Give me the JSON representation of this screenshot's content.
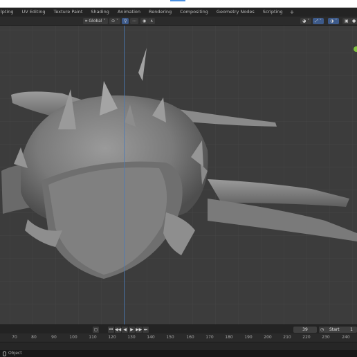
{
  "workspace_tabs": [
    "lpting",
    "UV Editing",
    "Texture Paint",
    "Shading",
    "Animation",
    "Rendering",
    "Compositing",
    "Geometry Nodes",
    "Scripting"
  ],
  "add_tab_label": "+",
  "header": {
    "transform_orientation": "Global",
    "pivot_label": "⊙",
    "snap_label": "⚲",
    "proportional_label": "◉",
    "overlay_icon": "overlay-icon",
    "shading_icon": "viewport-shading-icon"
  },
  "timeline": {
    "current_frame": "39",
    "start_label": "Start",
    "start_value": "1",
    "buttons": [
      "⏮",
      "◀◀",
      "◀",
      "▶",
      "▶▶",
      "⏭"
    ]
  },
  "ruler_ticks": [
    "70",
    "80",
    "90",
    "100",
    "110",
    "120",
    "130",
    "140",
    "150",
    "160",
    "170",
    "180",
    "190",
    "200",
    "210",
    "220",
    "230",
    "240"
  ],
  "status": {
    "mode_label": "Object"
  },
  "colors": {
    "viewport_bg": "#3c3c3c",
    "accent_blue": "#4a7ab8",
    "gizmo_green": "#7fbf3f"
  }
}
